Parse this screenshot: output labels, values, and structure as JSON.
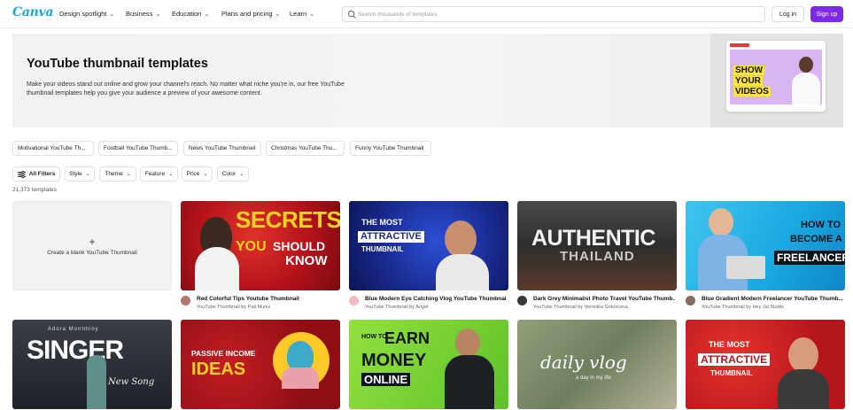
{
  "brand": {
    "logo": "Canva",
    "accent": "#7d2ae8",
    "logo_color": "#1aa6d8"
  },
  "nav": [
    {
      "label": "Design spotlight"
    },
    {
      "label": "Business"
    },
    {
      "label": "Education"
    },
    {
      "label": "Plans and pricing"
    },
    {
      "label": "Learn"
    }
  ],
  "search": {
    "placeholder": "Search thousands of templates",
    "value": ""
  },
  "auth": {
    "login": "Log in",
    "signup": "Sign up"
  },
  "hero": {
    "title": "YouTube thumbnail templates",
    "description": "Make your videos stand out online and grow your channel's reach. No matter what niche you're in, our free YouTube thumbnail templates help you give your audience a preview of your awesome content.",
    "art_text_1": "SHOW",
    "art_text_2": "YOUR",
    "art_text_3": "VIDEOS"
  },
  "categories": [
    "Motivational YouTube Th...",
    "Football YouTube Thumb...",
    "News YouTube Thumbnail",
    "Christmas YouTube Thu...",
    "Funny YouTube Thumbnail"
  ],
  "filters": {
    "all": "All Filters",
    "items": [
      "Style",
      "Theme",
      "Feature",
      "Price",
      "Color"
    ]
  },
  "template_count": "21,373 templates",
  "blank_card": {
    "plus": "+",
    "label": "Create a blank YouTube Thumbnail"
  },
  "cards_row1": [
    {
      "title": "Red Colorful Tips Youtube Thumbnail",
      "by": "YouTube Thumbnail by Pati Muniz",
      "art": [
        "SECRETS",
        "YOU",
        "SHOULD",
        "KNOW"
      ]
    },
    {
      "title": "Blue Modern Eye Catching Vlog YouTube Thumbnail",
      "by": "YouTube Thumbnail by Angel",
      "art": [
        "THE MOST",
        "ATTRACTIVE",
        "THUMBNAIL"
      ]
    },
    {
      "title": "Dark Grey Minimalist Photo Travel YouTube Thumb...",
      "by": "YouTube Thumbnail by Veronika Gotovceva",
      "art": [
        "AUTHENTIC",
        "THAILAND"
      ]
    },
    {
      "title": "Blue Gradient Modern Freelancer YouTube Thumb...",
      "by": "YouTube Thumbnail by Hey Jai Studio",
      "art": [
        "HOW TO",
        "BECOME A",
        "FREELANCER"
      ]
    }
  ],
  "cards_row2": [
    {
      "art": [
        "Adora Montminy",
        "SINGER",
        "New Song"
      ]
    },
    {
      "art": [
        "PASSIVE INCOME",
        "IDEAS"
      ]
    },
    {
      "art": [
        "HOW TO",
        "EARN",
        "MONEY",
        "ONLINE"
      ]
    },
    {
      "art": [
        "daily vlog",
        "a day in my life"
      ]
    },
    {
      "art": [
        "THE MOST",
        "ATTRACTIVE",
        "THUMBNAIL"
      ]
    }
  ]
}
